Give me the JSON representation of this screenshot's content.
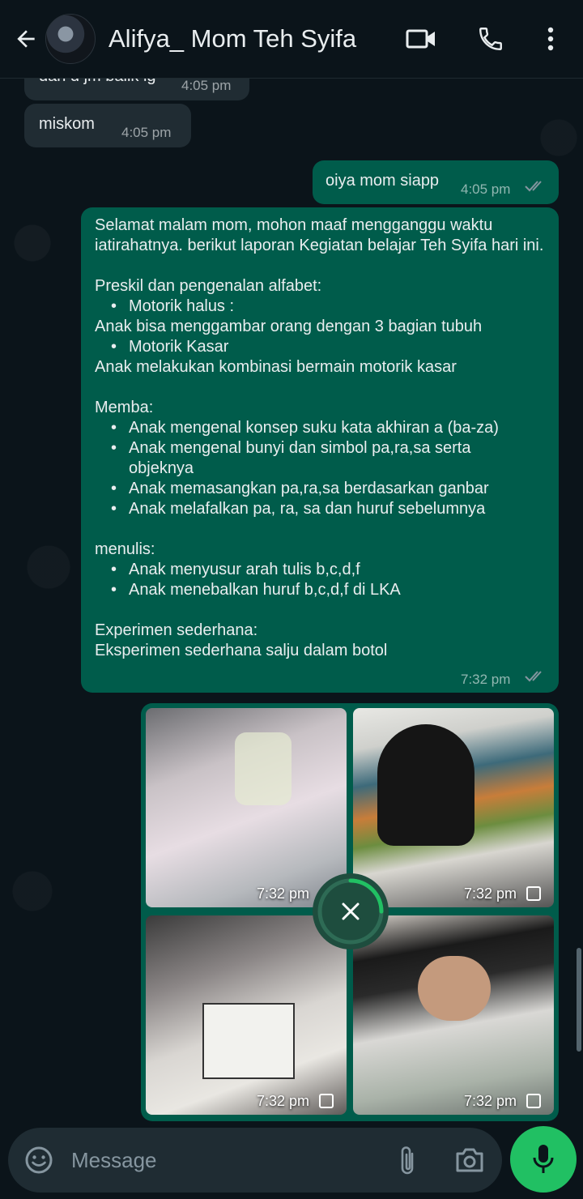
{
  "header": {
    "contact_name": "Alifya_ Mom Teh Syifa",
    "icons": [
      "back-arrow-icon",
      "video-call-icon",
      "phone-icon",
      "more-vert-icon"
    ]
  },
  "messages": [
    {
      "direction": "in",
      "text": "dan d jm balik lg",
      "time": "4:05 pm",
      "partial": true
    },
    {
      "direction": "in",
      "text": "miskom",
      "time": "4:05 pm"
    },
    {
      "direction": "out",
      "text": "oiya mom siapp",
      "time": "4:05 pm",
      "status": "read"
    },
    {
      "direction": "out",
      "time": "7:32 pm",
      "status": "read",
      "intro": "Selamat malam mom, mohon maaf mengganggu waktu iatirahatnya. berikut laporan Kegiatan belajar Teh Syifa hari ini.",
      "sec1_title": "Preskil dan pengenalan alfabet:",
      "sec1_b1": "Motorik halus :",
      "sec1_t1": "Anak bisa menggambar orang dengan 3 bagian tubuh",
      "sec1_b2": "Motorik Kasar",
      "sec1_t2": "Anak melakukan kombinasi bermain motorik kasar",
      "sec2_title": "Memba:",
      "sec2_items": [
        "Anak mengenal konsep suku kata akhiran a (ba-za)",
        "Anak mengenal bunyi dan simbol pa,ra,sa serta objeknya",
        "Anak memasangkan pa,ra,sa berdasarkan ganbar",
        "Anak melafalkan pa, ra, sa dan huruf sebelumnya"
      ],
      "sec3_title": "menulis:",
      "sec3_items": [
        "Anak menyusur arah tulis b,c,d,f",
        "Anak menebalkan huruf b,c,d,f di LKA"
      ],
      "sec4_title": "Experimen sederhana:",
      "sec4_text": "Eksperimen sederhana salju dalam botol"
    }
  ],
  "gallery": {
    "photos": [
      {
        "time": "7:32 pm",
        "pending": false
      },
      {
        "time": "7:32 pm",
        "pending": true
      },
      {
        "time": "7:32 pm",
        "pending": true
      },
      {
        "time": "7:32 pm",
        "pending": true
      }
    ],
    "upload_progress": 0.25
  },
  "composer": {
    "placeholder": "Message",
    "icons": [
      "emoji-icon",
      "attach-icon",
      "camera-icon",
      "mic-icon"
    ]
  },
  "colors": {
    "background": "#0b141a",
    "incoming": "#202c33",
    "outgoing": "#005c4b",
    "accent": "#21c063",
    "ticks": "#8696a0"
  }
}
